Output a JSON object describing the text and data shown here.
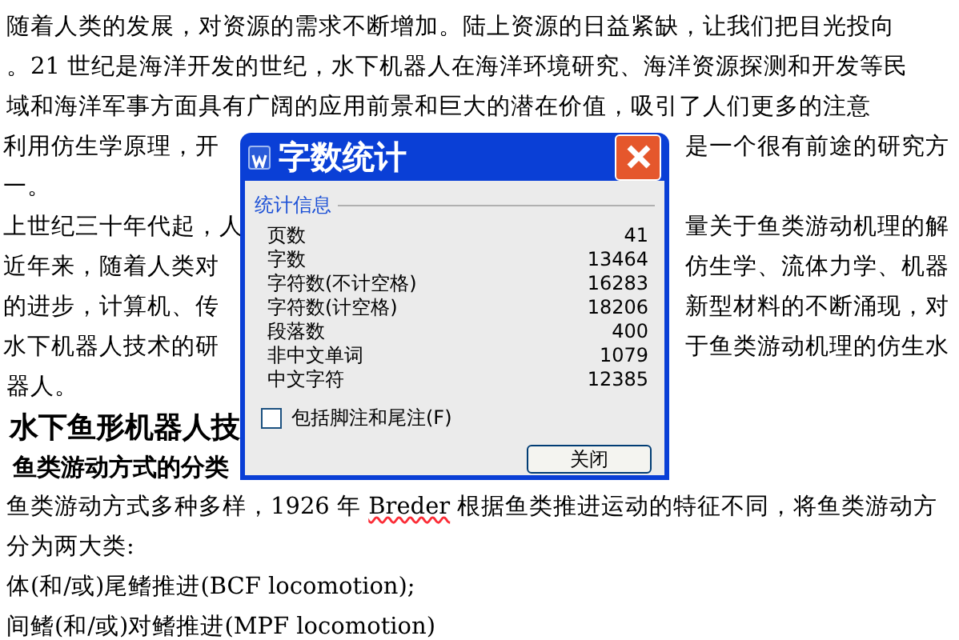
{
  "document": {
    "lines": [
      {
        "kind": "text",
        "segments": [
          {
            "text": "随着人类的发展，对资源的需求不断增加。陆上资源的日益紧缺，让我们把目光投向",
            "misspelled": false
          }
        ]
      },
      {
        "kind": "text",
        "segments": [
          {
            "text": "。21 世纪是海洋开发的世纪，水下机器人在海洋环境研究、海洋资源探测和开发等民",
            "misspelled": false
          }
        ]
      },
      {
        "kind": "text",
        "segments": [
          {
            "text": "域和海洋军事方面具有广阔的应用前景和巨大的潜在价值，吸引了人们更多的注意",
            "misspelled": false
          }
        ]
      },
      {
        "kind": "split",
        "left": "利用仿生学原理，开",
        "right": "是一个很有前途的研究方"
      },
      {
        "kind": "split",
        "left": "一。"
      },
      {
        "kind": "split",
        "left": "上世纪三十年代起，人",
        "right": "量关于鱼类游动机理的解"
      },
      {
        "kind": "split",
        "left": "近年来，随着人类对",
        "right": "仿生学、流体力学、机器"
      },
      {
        "kind": "split",
        "left": "的进步，计算机、传",
        "right": "新型材料的不断涌现，对"
      },
      {
        "kind": "split",
        "left": "水下机器人技术的研",
        "right": "于鱼类游动机理的仿生水"
      },
      {
        "kind": "text",
        "segments": [
          {
            "text": "器人。",
            "misspelled": false
          }
        ]
      },
      {
        "kind": "heading",
        "text": "水下鱼形机器人技"
      },
      {
        "kind": "subheading",
        "text": "鱼类游动方式的分类"
      },
      {
        "kind": "text",
        "segments": [
          {
            "text": "鱼类游动方式多种多样，1926 年 ",
            "misspelled": false
          },
          {
            "text": "Breder",
            "misspelled": true
          },
          {
            "text": " 根据鱼类推进运动的特征不同，将鱼类游动方",
            "misspelled": false
          }
        ]
      },
      {
        "kind": "text",
        "segments": [
          {
            "text": "分为两大类:",
            "misspelled": false
          }
        ]
      },
      {
        "kind": "text",
        "segments": [
          {
            "text": "体(和/或)尾鳍推进(BCF locomotion);",
            "misspelled": false
          }
        ]
      },
      {
        "kind": "text",
        "segments": [
          {
            "text": "间鳍(和/或)对鳍推进(MPF locomotion)",
            "misspelled": false
          }
        ]
      }
    ]
  },
  "dialog": {
    "title": "字数统计",
    "group_label": "统计信息",
    "stats": [
      {
        "label": "页数",
        "value": "41"
      },
      {
        "label": "字数",
        "value": "13464"
      },
      {
        "label": "字符数(不计空格)",
        "value": "16283"
      },
      {
        "label": "字符数(计空格)",
        "value": "18206"
      },
      {
        "label": "段落数",
        "value": "400"
      },
      {
        "label": "非中文单词",
        "value": "1079"
      },
      {
        "label": "中文字符",
        "value": "12385"
      }
    ],
    "checkbox": {
      "label": "包括脚注和尾注(F)",
      "checked": false
    },
    "button": "关闭"
  }
}
